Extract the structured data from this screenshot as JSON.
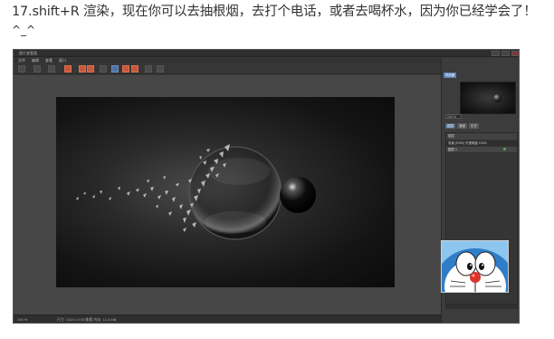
{
  "caption": "17.shift+R 渲染，现在你可以去抽根烟，去打个电话，或者去喝杯水，因为你已经学会了！",
  "emoticon": "^_^",
  "app": {
    "window_title": "图片查看器",
    "menus": [
      "文件",
      "编辑",
      "查看",
      "窗口"
    ],
    "panel_tab": "导航器",
    "zoom_field": "100 %",
    "mini_tabs": [
      "图层",
      "通道",
      "历史"
    ],
    "layer_header": "图层",
    "layer_row_1": "背景 (RGB)  不透明度 100%",
    "layer_row_2": "图层 1",
    "status_zoom": "100 %",
    "status_info": "尺寸: 1024 x 576 像素  内存: 12.3 MB"
  },
  "colors": {
    "app_bg": "#3a3a3a",
    "accent_blue": "#5c84b8",
    "toolbar_orange": "#c8583a",
    "active_indicator": "#4caf50"
  },
  "icons": {
    "toolbar": [
      "open-icon",
      "save-icon",
      "copy-icon",
      "render-icon",
      "crop-icon",
      "layer-icon",
      "brush-icon",
      "zoom-icon",
      "grid-icon",
      "view-icon",
      "settings-icon",
      "export-icon"
    ],
    "eye": "eye-icon"
  },
  "sticker": {
    "description_icon": "doraemon-sticker-icon"
  }
}
